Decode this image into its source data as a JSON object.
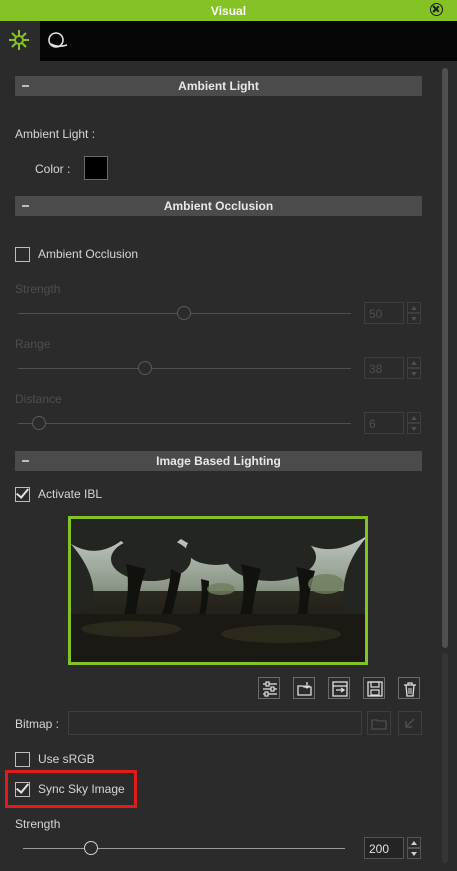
{
  "window": {
    "title": "Visual"
  },
  "tabs": [
    {
      "icon": "sun-icon",
      "active": true
    },
    {
      "icon": "environment-icon",
      "active": false
    }
  ],
  "ambient_light": {
    "header": "Ambient Light",
    "label": "Ambient Light :",
    "color_label": "Color :",
    "color_value": "#000000"
  },
  "ambient_occlusion": {
    "header": "Ambient Occlusion",
    "checkbox_label": "Ambient Occlusion",
    "checked": false,
    "strength": {
      "label": "Strength",
      "value": "50"
    },
    "range": {
      "label": "Range",
      "value": "38"
    },
    "distance": {
      "label": "Distance",
      "value": "6"
    }
  },
  "ibl": {
    "header": "Image Based Lighting",
    "activate_label": "Activate IBL",
    "activate_checked": true,
    "toolbar_icons": [
      "settings-sliders-icon",
      "open-folder-icon",
      "import-icon",
      "save-icon",
      "delete-icon"
    ],
    "bitmap_label": "Bitmap :",
    "bitmap_value": "",
    "use_srgb_label": "Use sRGB",
    "use_srgb_checked": false,
    "sync_sky_label": "Sync Sky Image",
    "sync_sky_checked": true,
    "strength_label": "Strength",
    "strength_value": "200"
  },
  "colors": {
    "accent": "#84c226",
    "highlight": "#e01b1b",
    "panel": "#2b2b2b"
  }
}
